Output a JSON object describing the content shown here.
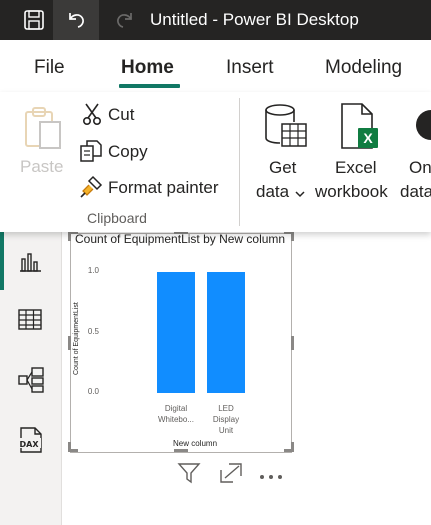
{
  "window": {
    "title": "Untitled - Power BI Desktop"
  },
  "quick_access": {
    "save_icon": "save-icon",
    "undo_icon": "undo-icon",
    "redo_icon": "redo-icon"
  },
  "menu": {
    "tabs": [
      {
        "label": "File",
        "active": false
      },
      {
        "label": "Home",
        "active": true
      },
      {
        "label": "Insert",
        "active": false
      },
      {
        "label": "Modeling",
        "active": false
      }
    ]
  },
  "ribbon": {
    "clipboard": {
      "paste_label": "Paste",
      "cut_label": "Cut",
      "copy_label": "Copy",
      "format_painter_label": "Format painter",
      "group_label": "Clipboard"
    },
    "data": {
      "get_data_label_1": "Get",
      "get_data_label_2": "data",
      "excel_label_1": "Excel",
      "excel_label_2": "workbook",
      "onelake_label_1": "On",
      "onelake_label_2": "data"
    }
  },
  "leftnav": {
    "items": [
      {
        "name": "report-view",
        "icon": "bar-chart-icon",
        "active": true
      },
      {
        "name": "table-view",
        "icon": "table-icon",
        "active": false
      },
      {
        "name": "model-view",
        "icon": "model-icon",
        "active": false
      },
      {
        "name": "dax-query-view",
        "icon": "dax-icon",
        "active": false
      }
    ]
  },
  "colors": {
    "accent": "#117865",
    "bar": "#118dff",
    "titlebar": "#252423"
  },
  "chart_data": {
    "type": "bar",
    "title": "Count of EquipmentList by New column",
    "xlabel": "New column",
    "ylabel": "Count of EquipmentList",
    "categories": [
      "Digital Whitebo...",
      "LED Display Unit"
    ],
    "category_lines": [
      [
        "Digital",
        "Whitebo..."
      ],
      [
        "LED",
        "Display",
        "Unit"
      ]
    ],
    "values": [
      1,
      1
    ],
    "ylim": [
      0,
      1
    ],
    "yticks": [
      "1.0",
      "0.5",
      "0.0"
    ],
    "grid": false,
    "legend": "none"
  }
}
